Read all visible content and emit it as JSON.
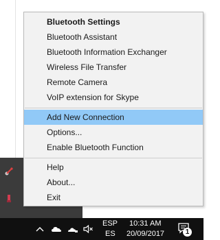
{
  "menu": {
    "items": [
      {
        "label": "Bluetooth Settings",
        "bold": true
      },
      {
        "label": "Bluetooth Assistant"
      },
      {
        "label": "Bluetooth Information Exchanger"
      },
      {
        "label": "Wireless File Transfer"
      },
      {
        "label": "Remote Camera"
      },
      {
        "label": "VoIP extension for Skype"
      },
      {
        "label": "Add New Connection",
        "highlighted": true
      },
      {
        "label": "Options..."
      },
      {
        "label": "Enable Bluetooth Function"
      },
      {
        "label": "Help"
      },
      {
        "label": "About..."
      },
      {
        "label": "Exit"
      }
    ],
    "highlight_color": "#91c9f7"
  },
  "taskbar": {
    "language_code": "ESP",
    "keyboard_layout": "ES",
    "time": "10:31 AM",
    "date": "20/09/2017",
    "notification_count": "1",
    "icons": [
      "chevron-up-icon",
      "cloud-icon",
      "speaker-muted-icon",
      "action-center-icon"
    ]
  }
}
